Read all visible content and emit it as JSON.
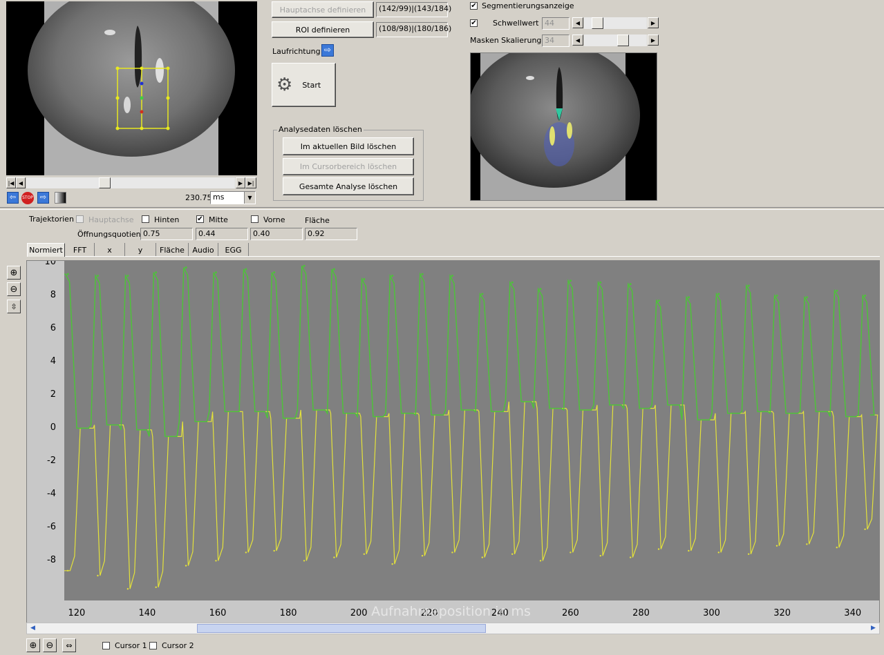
{
  "video_panel": {
    "time_value": "230.75",
    "time_unit": "ms"
  },
  "controls": {
    "hauptachse_label": "Hauptachse definieren",
    "hauptachse_value": "(142/99)|(143/184)",
    "roi_label": "ROI definieren",
    "roi_value": "(108/98)|(180/186)",
    "laufrichtung_label": "Laufrichtung",
    "start_label": "Start"
  },
  "analysis_delete": {
    "group_label": "Analysedaten löschen",
    "current_image": "Im aktuellen Bild löschen",
    "cursor_range": "Im Cursorbereich löschen",
    "all": "Gesamte Analyse löschen"
  },
  "segmentation": {
    "display_label": "Segmentierungsanzeige",
    "threshold_label": "Schwellwert",
    "threshold_value": "44",
    "mask_scale_label": "Masken Skalierung",
    "mask_scale_value": "34"
  },
  "trajectories": {
    "label": "Trajektorien",
    "hauptachse": "Hauptachse",
    "hinten": "Hinten",
    "mitte": "Mitte",
    "vorne": "Vorne",
    "flaeche": "Fläche",
    "quotient_label": "Öffnungsquotient",
    "q_hinten": "0.75",
    "q_mitte": "0.44",
    "q_vorne": "0.40",
    "q_flaeche": "0.92"
  },
  "tabs": [
    "Normiert",
    "FFT",
    "x",
    "y",
    "Fläche",
    "Audio",
    "EGG"
  ],
  "bottom": {
    "cursor1": "Cursor 1",
    "cursor2": "Cursor 2"
  },
  "chart_data": {
    "type": "line",
    "xlabel": "Aufnahmeposition in ms",
    "xlim": [
      116.5,
      347.5
    ],
    "ylim": [
      -10.5,
      10
    ],
    "x_ticks": [
      120,
      140,
      160,
      180,
      200,
      220,
      240,
      260,
      280,
      300,
      320,
      340
    ],
    "y_ticks": [
      10,
      8,
      6,
      4,
      2,
      0,
      -2,
      -4,
      -6,
      -8
    ],
    "grid": false,
    "colors": {
      "plot_bg": "#808080",
      "upper": "#4ec23a",
      "lower": "#e4e23a"
    },
    "series": [
      {
        "peak_x": [
          117.5,
          126,
          134.5,
          142.5,
          151,
          159.5,
          168,
          176,
          184.5,
          193,
          201.5,
          209.5,
          218,
          226.5,
          235,
          243.5,
          251.5,
          260,
          268.5,
          277,
          285,
          293.5,
          302,
          310.5,
          318.5,
          327,
          335.5,
          343.5
        ],
        "peak_y": [
          9.2,
          9.1,
          9.1,
          9.3,
          9.6,
          9.3,
          9.5,
          9.3,
          9.7,
          9.5,
          8.9,
          9.1,
          9.2,
          9.1,
          8.0,
          8.7,
          8.3,
          8.8,
          8.7,
          8.6,
          7.6,
          7.8,
          8.0,
          8.5,
          7.9,
          7.8,
          8.2,
          7.9
        ],
        "base_y": [
          -0.1,
          0.1,
          -0.2,
          -0.6,
          0.3,
          0.9,
          0.9,
          0.5,
          1.0,
          0.8,
          0.6,
          0.8,
          0.7,
          1.0,
          0.9,
          1.5,
          1.1,
          1.0,
          1.3,
          1.1,
          1.3,
          0.4,
          0.8,
          0.9,
          0.8,
          0.9,
          0.6,
          0.7
        ]
      },
      {
        "trough_x": [
          117.5,
          126,
          134.5,
          142.5,
          151,
          159.5,
          168,
          176,
          184.5,
          193,
          201.5,
          209.5,
          218,
          226.5,
          235,
          243.5,
          251.5,
          260,
          268.5,
          277,
          285,
          293.5,
          302,
          310.5,
          318.5,
          327,
          335.5,
          343.5
        ],
        "trough_y": [
          -8.7,
          -9.0,
          -9.8,
          -9.7,
          -8.4,
          -8.1,
          -7.6,
          -7.5,
          -8.1,
          -7.9,
          -7.7,
          -8.3,
          -7.8,
          -7.6,
          -7.9,
          -7.7,
          -8.1,
          -7.6,
          -7.8,
          -7.9,
          -7.4,
          -7.5,
          -7.6,
          -7.7,
          -7.2,
          -7.1,
          -7.3,
          -6.2
        ]
      }
    ]
  }
}
